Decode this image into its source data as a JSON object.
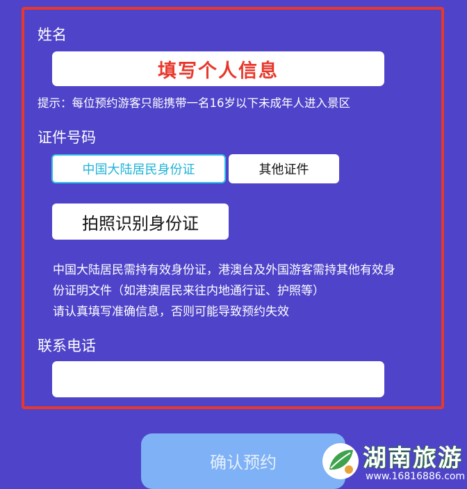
{
  "form": {
    "name_label": "姓名",
    "name_placeholder": "填写个人信息",
    "hint": "提示：每位预约游客只能携带一名16岁以下未成年人进入景区",
    "id_label": "证件号码",
    "id_types": [
      {
        "label": "中国大陆居民身份证",
        "selected": true
      },
      {
        "label": "其他证件",
        "selected": false
      }
    ],
    "scan_button": "拍照识别身份证",
    "notes": [
      "中国大陆居民需持有效身份证，港澳台及外国游客需持其他有效身",
      "份证明文件（如港澳居民来往内地通行证、护照等）",
      "请认真填写准确信息，否则可能导致预约失效"
    ],
    "phone_label": "联系电话",
    "phone_value": ""
  },
  "confirm_button": "确认预约",
  "watermark": {
    "text": "湖南旅游",
    "url": "www.16816886.com"
  },
  "colors": {
    "background": "#4f44c9",
    "highlight_border": "#e8382c",
    "selected_accent": "#1fb3d8",
    "confirm_button": "#7eb1f5"
  }
}
